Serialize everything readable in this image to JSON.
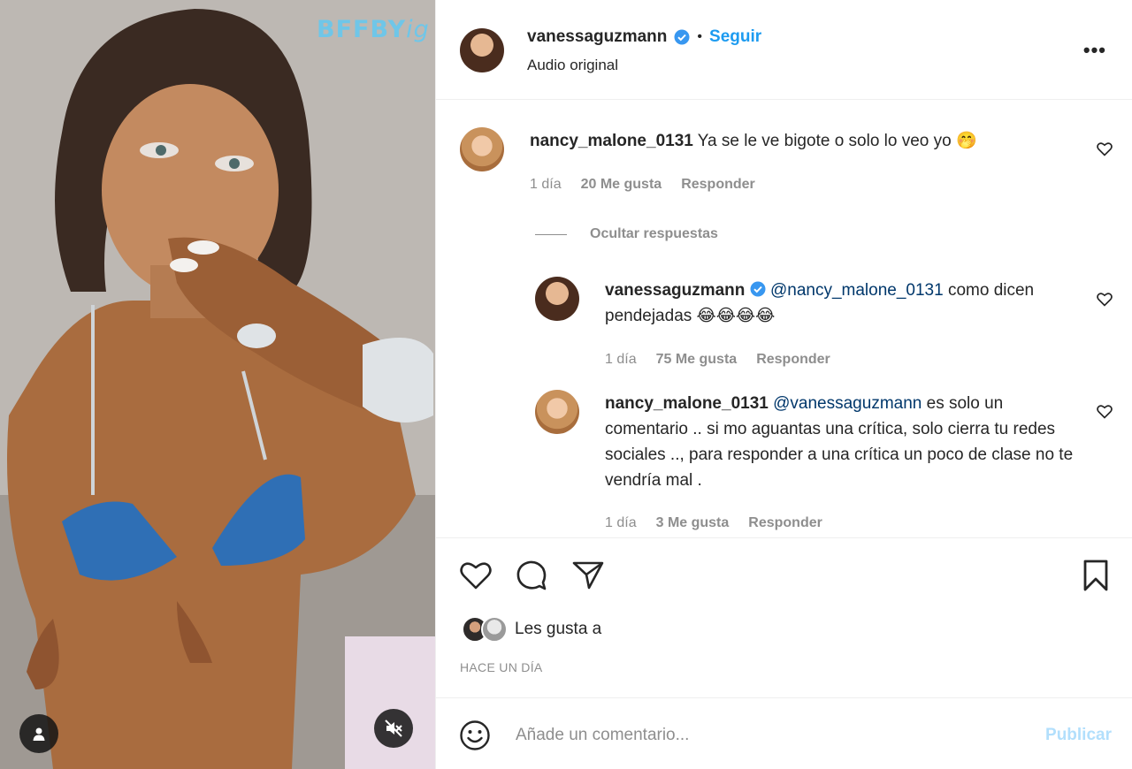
{
  "media": {
    "watermark_main": "BFFBY",
    "watermark_tail": "ig"
  },
  "header": {
    "username": "vanessaguzmann",
    "dot": "•",
    "follow": "Seguir",
    "subtitle": "Audio original",
    "more": "•••"
  },
  "comments": [
    {
      "username": "nancy_malone_0131",
      "text": "Ya se le ve bigote o solo lo veo yo 🤭",
      "time": "1 día",
      "likes": "20 Me gusta",
      "reply": "Responder"
    }
  ],
  "hide_replies": "Ocultar respuestas",
  "replies": [
    {
      "username": "vanessaguzmann",
      "mention": "@nancy_malone_0131",
      "text": " como dicen pendejadas 😂😂😂😂",
      "time": "1 día",
      "likes": "75 Me gusta",
      "reply": "Responder"
    },
    {
      "username": "nancy_malone_0131",
      "mention": "@vanessaguzmann",
      "text": " es solo un comentario .. si mo aguantas una crítica, solo cierra tu redes sociales .., para responder a una crítica un poco de clase no te vendría mal .",
      "time": "1 día",
      "likes": "3 Me gusta",
      "reply": "Responder"
    }
  ],
  "actions": {
    "liked_by": "Les gusta a",
    "time_ago": "HACE UN DÍA"
  },
  "composer": {
    "placeholder": "Añade un comentario...",
    "publish": "Publicar"
  },
  "colors": {
    "accent": "#1d9bf0",
    "publish_disabled": "#b2dffc",
    "muted": "#8e8e8e",
    "mention": "#00376b"
  }
}
